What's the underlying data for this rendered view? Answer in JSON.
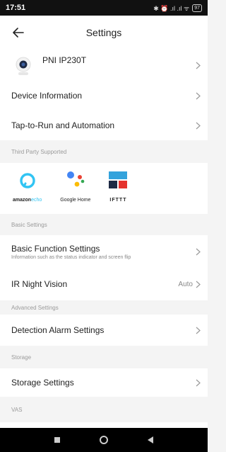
{
  "status_bar": {
    "time": "17:51",
    "icons": "✱ ⏰ .ıl .ıl ᯤ",
    "battery": "97"
  },
  "header": {
    "title": "Settings"
  },
  "device": {
    "name": "PNI IP230T"
  },
  "rows": {
    "device_information": "Device Information",
    "tap_to_run": "Tap-to-Run and Automation"
  },
  "groups": {
    "third_party": "Third Party Supported",
    "basic": "Basic Settings",
    "advanced": "Advanced Settings",
    "storage": "Storage",
    "vas": "VAS"
  },
  "third_party": {
    "echo_brand": "amazon",
    "echo_product": "echo",
    "google_home": "Google Home",
    "ifttt": "IFTTT"
  },
  "basic_settings": {
    "function_settings": "Basic Function Settings",
    "function_settings_desc": "Information such as the status indicator and screen flip",
    "ir_night_vision": "IR Night Vision",
    "ir_night_vision_value": "Auto"
  },
  "advanced_settings": {
    "detection_alarm": "Detection Alarm Settings"
  },
  "storage_settings": {
    "label": "Storage Settings"
  },
  "colors": {
    "alexa_blue": "#31c4f3",
    "google_blue": "#4285f4",
    "google_red": "#ea4335",
    "google_yellow": "#fbbc05",
    "google_green": "#34a853",
    "ifttt_blue": "#33a3dc",
    "ifttt_red": "#e5322d"
  }
}
